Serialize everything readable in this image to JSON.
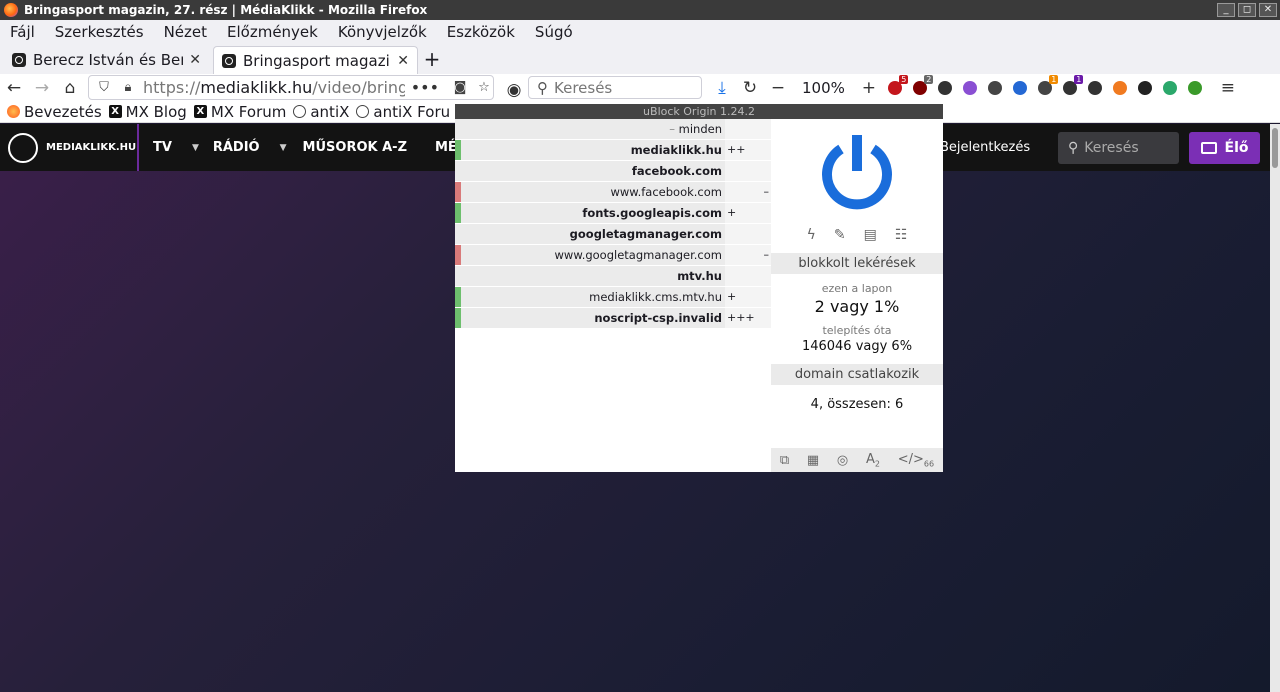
{
  "window": {
    "title": "Bringasport magazin, 27. rész | MédiaKlikk - Mozilla Firefox"
  },
  "menu": [
    "Fájl",
    "Szerkesztés",
    "Nézet",
    "Előzmények",
    "Könyvjelzők",
    "Eszközök",
    "Súgó"
  ],
  "tabs": [
    {
      "label": "Berecz István és Ber",
      "active": false
    },
    {
      "label": "Bringasport magazin",
      "active": true
    }
  ],
  "nav": {
    "url_prefix": "https://",
    "url_domain": "mediaklikk.hu",
    "url_path": "/video/bringa",
    "search_placeholder": "Keresés",
    "zoom": "100%"
  },
  "extensions": [
    {
      "name": "ublock-icon-a",
      "color": "#c4161c",
      "badge": "5",
      "badge_color": "#c4161c"
    },
    {
      "name": "ublock-icon",
      "color": "#800000",
      "badge": "2",
      "badge_color": "#666"
    },
    {
      "name": "multi-color-icon",
      "color": "#333"
    },
    {
      "name": "cube-icon",
      "color": "#8a4fd3"
    },
    {
      "name": "building-icon",
      "color": "#444"
    },
    {
      "name": "document-icon",
      "color": "#2468d4"
    },
    {
      "name": "pen-icon",
      "color": "#444",
      "badge": "1",
      "badge_color": "#f08a00"
    },
    {
      "name": "equalizer-icon",
      "color": "#333",
      "badge": "1",
      "badge_color": "#6a1aa8"
    },
    {
      "name": "grid-icon",
      "color": "#333"
    },
    {
      "name": "basketball-icon",
      "color": "#f07a20"
    },
    {
      "name": "arrow-circle-icon",
      "color": "#222"
    },
    {
      "name": "green-circle-icon",
      "color": "#2ba86b"
    },
    {
      "name": "b-plus-icon",
      "color": "#3a9a2a"
    }
  ],
  "bookmarks": [
    {
      "label": "Bevezetés",
      "icon": "firefox-icon"
    },
    {
      "label": "MX Blog",
      "icon": "mx-icon"
    },
    {
      "label": "MX Forum",
      "icon": "mx-icon"
    },
    {
      "label": "antiX",
      "icon": "globe-icon"
    },
    {
      "label": "antiX Foru",
      "icon": "globe-icon"
    }
  ],
  "site": {
    "logo": "MEDIAKLIKK.HU",
    "nav": [
      "TV",
      "RÁDIÓ",
      "MŰSOROK A-Z",
      "MÉDIAT"
    ],
    "login": "Bejelentkezés",
    "search_placeholder": "Keresés",
    "live": "Élő"
  },
  "ublock": {
    "header": "uBlock Origin 1.24.2",
    "rows": [
      {
        "prefix": "– ",
        "host": "minden",
        "bold": false,
        "count": "",
        "bar": "#ebebeb"
      },
      {
        "prefix": "",
        "host": "mediaklikk.hu",
        "bold": true,
        "count": "++",
        "bar": "#6dbf6d"
      },
      {
        "prefix": "",
        "host": "facebook.com",
        "bold": true,
        "count": "",
        "bar": "#ebebeb"
      },
      {
        "prefix": "",
        "host": "www.facebook.com",
        "bold": false,
        "count": "–",
        "bar": "#d97a7a"
      },
      {
        "prefix": "",
        "host": "fonts.googleapis.com",
        "bold": true,
        "count": "+",
        "bar": "#6dbf6d"
      },
      {
        "prefix": "",
        "host": "googletagmanager.com",
        "bold": true,
        "count": "",
        "bar": "#ebebeb"
      },
      {
        "prefix": "",
        "host": "www.googletagmanager.com",
        "bold": false,
        "count": "–",
        "bar": "#d97a7a"
      },
      {
        "prefix": "",
        "host": "mtv.hu",
        "bold": true,
        "count": "",
        "bar": "#ebebeb"
      },
      {
        "prefix": "",
        "host": "mediaklikk.cms.mtv.hu",
        "bold": false,
        "count": "+",
        "bar": "#6dbf6d"
      },
      {
        "prefix": "",
        "host": "noscript-csp.invalid",
        "bold": true,
        "count": "+++",
        "bar": "#6dbf6d"
      }
    ],
    "blocked_title": "blokkolt lekérések",
    "on_page_label": "ezen a lapon",
    "on_page_value": "2 vagy 1%",
    "since_install_label": "telepítés óta",
    "since_install_value": "146046 vagy 6%",
    "domains_title": "domain csatlakozik",
    "domains_value": "4, összesen: 6",
    "footer_font_count": "2",
    "footer_script_count": "66",
    "power_color": "#1a6ddb"
  }
}
